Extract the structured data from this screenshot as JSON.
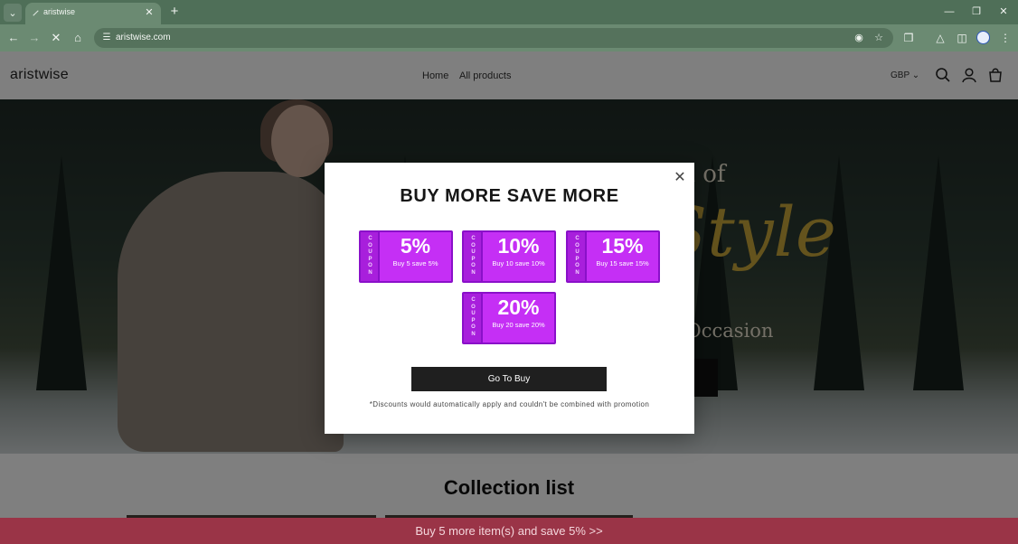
{
  "browser": {
    "tab_title": "aristwise",
    "url": "aristwise.com"
  },
  "site": {
    "logo": "aristwise",
    "menu": [
      "Home",
      "All products"
    ],
    "currency": "GBP",
    "hero": {
      "line1": "dom of",
      "script": "Style",
      "line2": "y Occasion"
    },
    "collection_title": "Collection list"
  },
  "modal": {
    "title": "BUY MORE SAVE MORE",
    "coupon_word": "C O U P O N",
    "coupons": [
      {
        "pct": "5%",
        "desc": "Buy 5 save 5%"
      },
      {
        "pct": "10%",
        "desc": "Buy 10 save 10%"
      },
      {
        "pct": "15%",
        "desc": "Buy 15 save 15%"
      },
      {
        "pct": "20%",
        "desc": "Buy 20 save 20%"
      }
    ],
    "button": "Go To Buy",
    "note": "*Discounts would automatically apply and couldn't be combined with promotion"
  },
  "promo_bar": {
    "text": "Buy 5 more item(s) and save 5%  >>"
  },
  "colors": {
    "browser_frame": "#4f6f58",
    "coupon_fill": "#c52ff5",
    "coupon_border": "#8a10c9",
    "promo_bar": "#9a3447"
  }
}
